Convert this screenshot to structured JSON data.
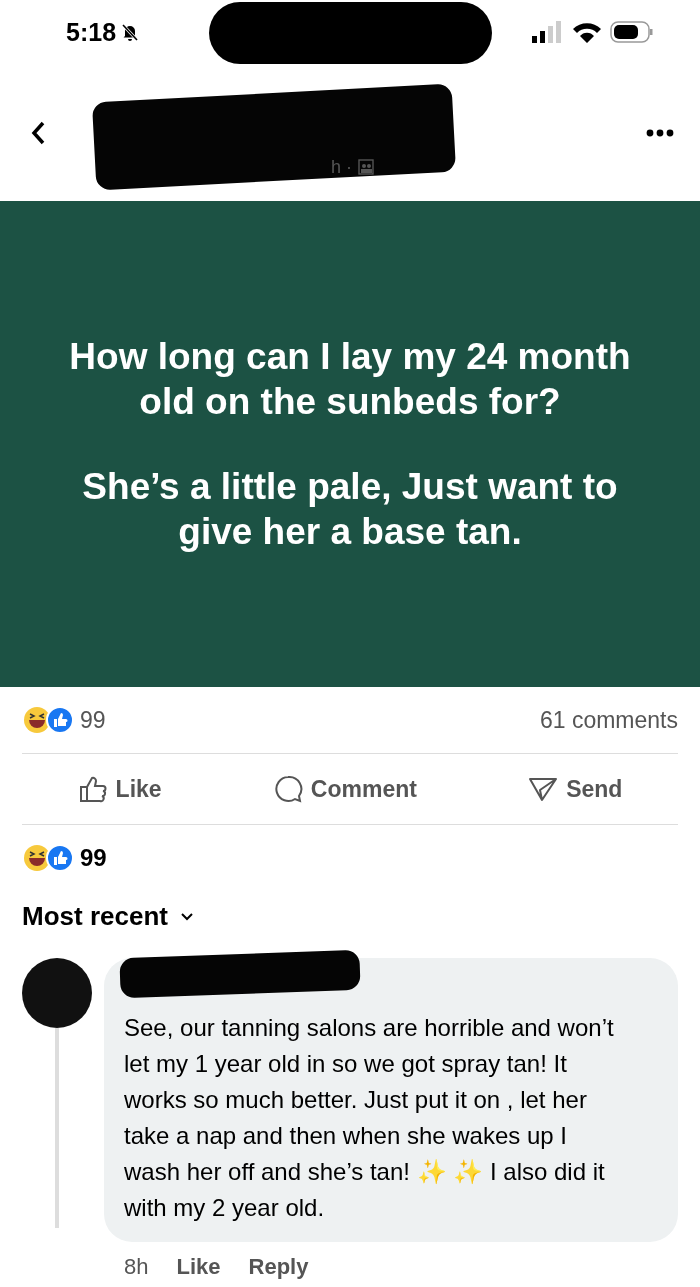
{
  "status_bar": {
    "time": "5:18"
  },
  "header": {
    "subtitle": "h ·"
  },
  "post": {
    "lines": [
      "How long can I lay my 24 month old on the sunbeds for?",
      "She’s a little pale, Just want to give her a base tan."
    ]
  },
  "stats": {
    "reaction_count": "99",
    "comments": "61 comments"
  },
  "actions": [
    {
      "kind": "like",
      "label": "Like"
    },
    {
      "kind": "comment",
      "label": "Comment"
    },
    {
      "kind": "send",
      "label": "Send"
    }
  ],
  "reactions": {
    "count": "99"
  },
  "sort": {
    "label": "Most recent"
  },
  "comment": {
    "text": "See, our tanning salons are horrible and won’t let my 1 year old in so we got spray tan! It works so much better. Just put it on , let her take a nap and then when she wakes up I wash her off and she’s tan! ✨ ✨ I also did it with my 2 year old.",
    "time": "8h",
    "like": "Like",
    "reply": "Reply"
  }
}
